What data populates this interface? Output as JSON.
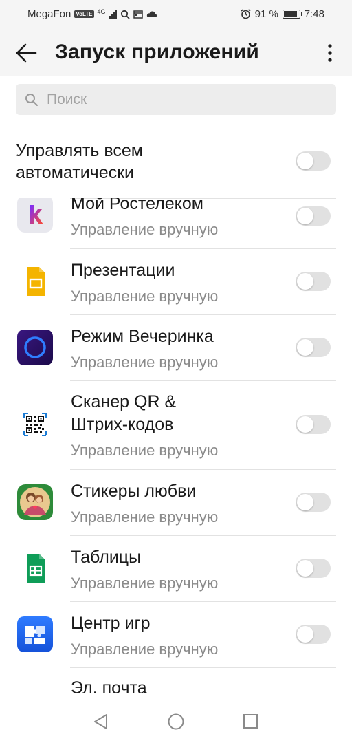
{
  "status_bar": {
    "carrier": "MegaFon",
    "volte": "VoLTE",
    "network": "4G",
    "alarm_icon": "alarm-clock-icon",
    "battery_text": "91 %",
    "battery_level": 0.91,
    "time": "7:48"
  },
  "header": {
    "title": "Запуск приложений",
    "back_icon": "arrow-left-icon",
    "more_icon": "more-vertical-icon"
  },
  "search": {
    "placeholder": "Поиск"
  },
  "master": {
    "label": "Управлять всем автоматически",
    "enabled": false
  },
  "apps": [
    {
      "name": "Мой Ростелеком",
      "status": "Управление вручную",
      "enabled": false,
      "icon": "rostelecom-icon"
    },
    {
      "name": "Презентации",
      "status": "Управление вручную",
      "enabled": false,
      "icon": "slides-icon"
    },
    {
      "name": "Режим Вечеринка",
      "status": "Управление вручную",
      "enabled": false,
      "icon": "party-mode-icon"
    },
    {
      "name_line1": "Сканер QR &",
      "name_line2": "Штрих-кодов",
      "status": "Управление вручную",
      "enabled": false,
      "icon": "qr-code-icon"
    },
    {
      "name": "Стикеры любви",
      "status": "Управление вручную",
      "enabled": false,
      "icon": "love-stickers-icon"
    },
    {
      "name": "Таблицы",
      "status": "Управление вручную",
      "enabled": false,
      "icon": "sheets-icon"
    },
    {
      "name": "Центр игр",
      "status": "Управление вручную",
      "enabled": false,
      "icon": "game-center-icon"
    },
    {
      "name": "Эл. почта",
      "icon": "email-icon"
    }
  ],
  "colors": {
    "header_bg": "#f5f5f5",
    "toggle_off": "#e1e1e1",
    "subtitle": "#8a8a8a",
    "divider": "#e2e2e2"
  }
}
